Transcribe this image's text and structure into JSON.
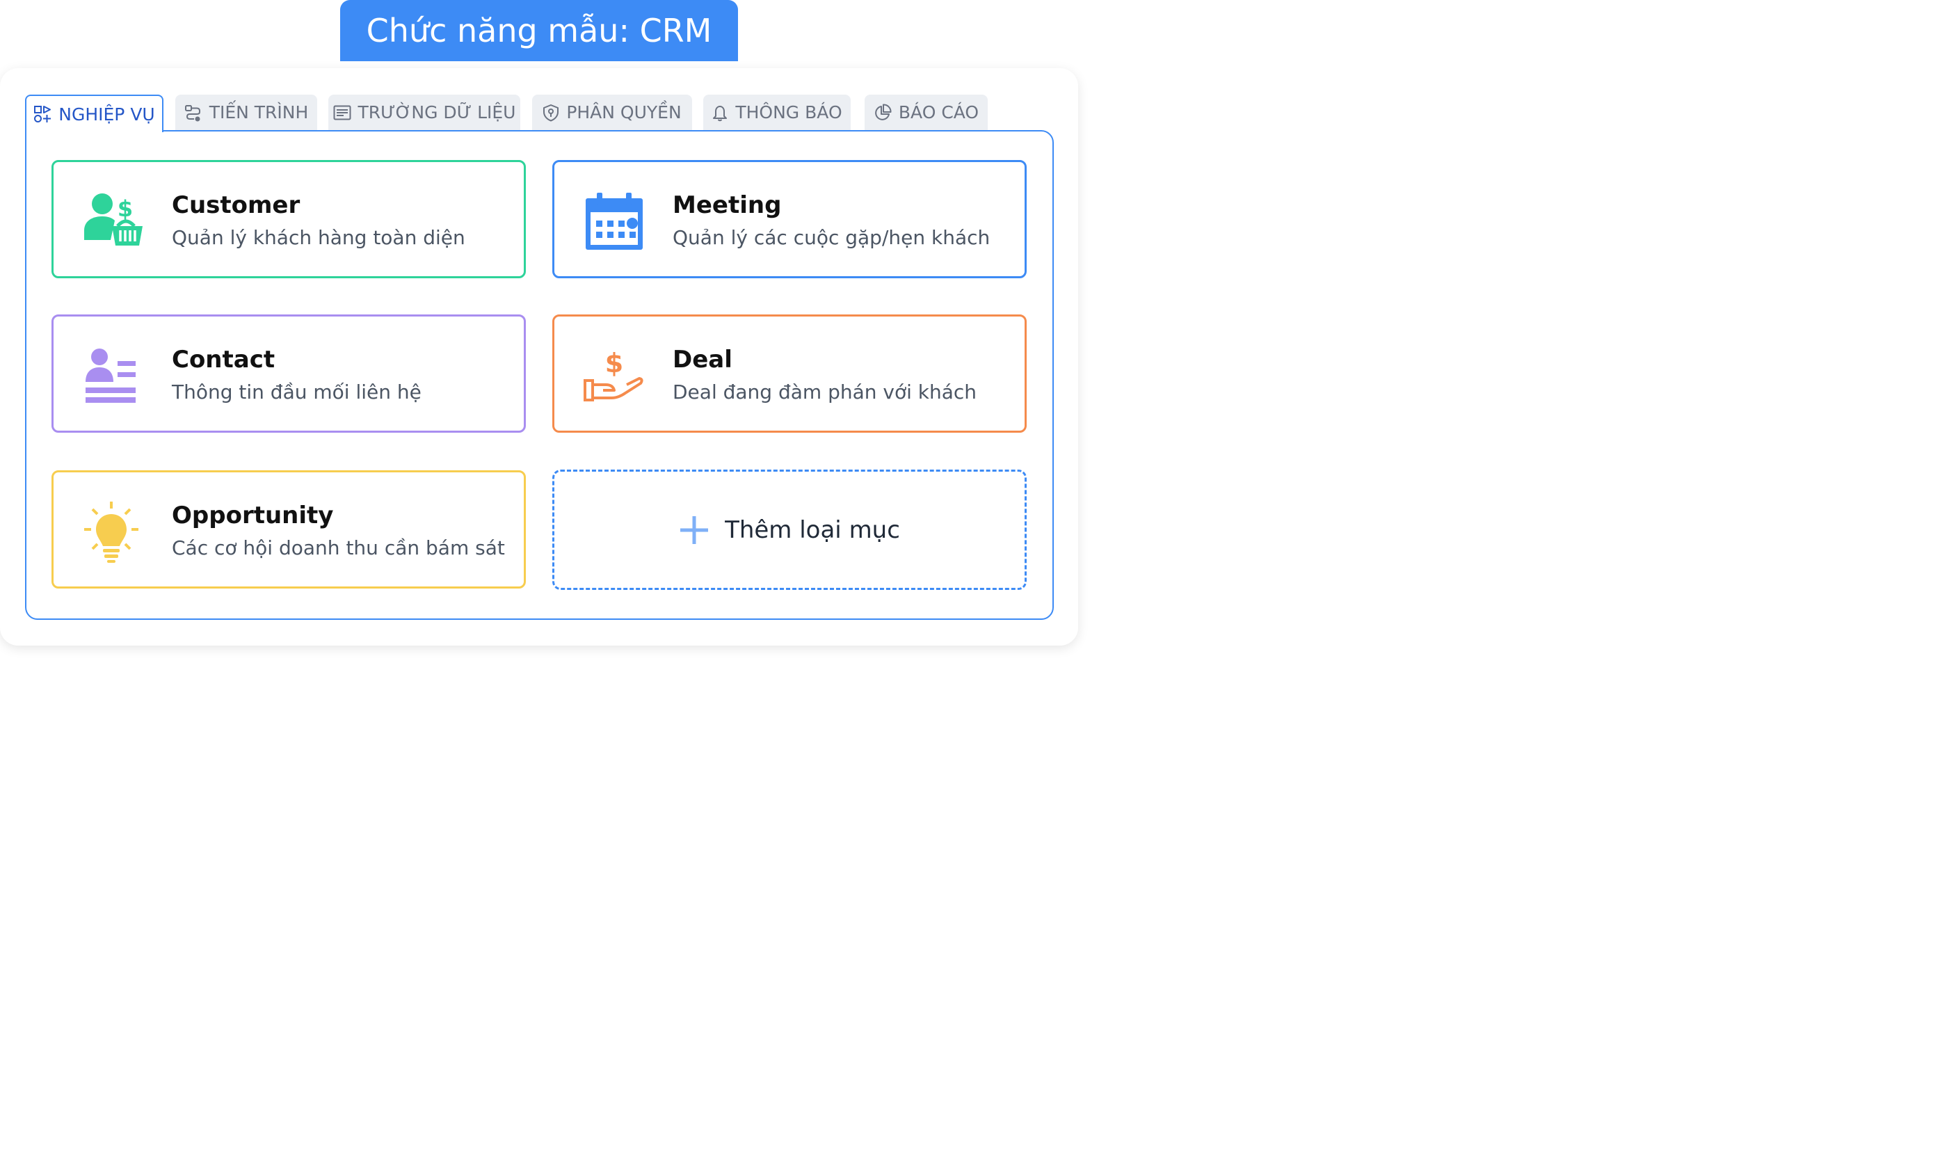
{
  "banner": {
    "title": "Chức năng mẫu: CRM"
  },
  "tabs": [
    {
      "label": "NGHIỆP VỤ",
      "icon": "shapes-icon",
      "active": true
    },
    {
      "label": "TIẾN TRÌNH",
      "icon": "workflow-icon",
      "active": false
    },
    {
      "label": "TRƯỜNG DỮ LIỆU",
      "icon": "fields-icon",
      "active": false
    },
    {
      "label": "PHÂN QUYỀN",
      "icon": "shield-key-icon",
      "active": false
    },
    {
      "label": "THÔNG BÁO",
      "icon": "bell-icon",
      "active": false
    },
    {
      "label": "BÁO CÁO",
      "icon": "pie-chart-icon",
      "active": false
    }
  ],
  "cards": [
    {
      "title": "Customer",
      "description": "Quản lý khách hàng toàn diện",
      "icon": "customer-basket-icon",
      "color": "#2ed39a"
    },
    {
      "title": "Meeting",
      "description": "Quản lý các cuộc gặp/hẹn khách",
      "icon": "calendar-icon",
      "color": "#3d8bf5"
    },
    {
      "title": "Contact",
      "description": "Thông tin đầu mối liên hệ",
      "icon": "contact-card-icon",
      "color": "#a98ef0"
    },
    {
      "title": "Deal",
      "description": "Deal đang đàm phán với khách",
      "icon": "hand-dollar-icon",
      "color": "#f58b4c"
    },
    {
      "title": "Opportunity",
      "description": "Các cơ hội doanh thu cần bám sát",
      "icon": "lightbulb-icon",
      "color": "#f7cd4f"
    }
  ],
  "add_item": {
    "label": "Thêm loại mục",
    "icon": "plus-icon"
  },
  "colors": {
    "accent": "#3d8bf5",
    "active_tab_text": "#2456c7"
  }
}
